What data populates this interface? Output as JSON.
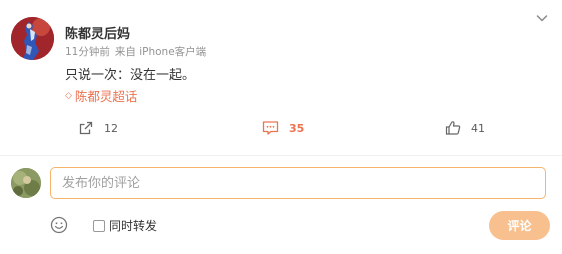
{
  "post": {
    "author": "陈都灵后妈",
    "time": "11分钟前",
    "source": "来自 iPhone客户端",
    "text": "只说一次：没在一起。",
    "topic": "陈都灵超话"
  },
  "actions": {
    "repost_count": "12",
    "comment_count": "35",
    "like_count": "41"
  },
  "comment_box": {
    "placeholder": "发布你的评论",
    "repost_label": "同时转发",
    "submit_label": "评论"
  },
  "colors": {
    "accent": "#eb7350",
    "input_border": "#f7b46d",
    "submit_bg": "#f8c08e"
  }
}
